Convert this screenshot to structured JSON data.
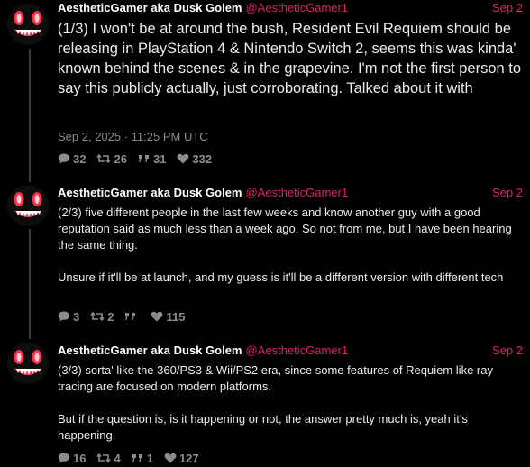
{
  "tweets": [
    {
      "author": "AestheticGamer aka Dusk Golem",
      "handle": "@AestheticGamer1",
      "date": "Sep 2",
      "text": "(1/3) I won't be at around the bush, Resident Evil Requiem should be releasing in PlayStation 4 & Nintendo Switch 2, seems this was kinda' known behind the scenes & in the grapevine. I'm not the first person to say this publicly actually, just corroborating. Talked about it with",
      "timestamp": "Sep 2, 2025 · 11:25 PM UTC",
      "stats": {
        "replies": "32",
        "retweets": "26",
        "quotes": "31",
        "likes": "332"
      }
    },
    {
      "author": "AestheticGamer aka Dusk Golem",
      "handle": "@AestheticGamer1",
      "date": "Sep 2",
      "paragraphs": [
        "(2/3) five different people in the last few weeks and know another guy with a good reputation said as much less than a week ago. So not from me, but I have been hearing the same thing.",
        "Unsure if it'll be at launch, and my guess is it'll be a different version with different tech"
      ],
      "stats": {
        "replies": "3",
        "retweets": "2",
        "quotes": "",
        "likes": "115"
      }
    },
    {
      "author": "AestheticGamer aka Dusk Golem",
      "handle": "@AestheticGamer1",
      "date": "Sep 2",
      "paragraphs": [
        "(3/3) sorta' like the 360/PS3 & Wii/PS2 era, since some features of Requiem like ray tracing are focused on modern platforms.",
        "But if the question is, is it happening or not, the answer pretty much is, yeah it's happening."
      ],
      "stats": {
        "replies": "16",
        "retweets": "4",
        "quotes": "1",
        "likes": "127"
      }
    }
  ],
  "icons": {
    "reply": "comment-icon",
    "retweet": "retweet-icon",
    "quote": "quote-icon",
    "like": "heart-icon"
  },
  "colors": {
    "background": "#000000",
    "handle": "#e0245e",
    "meta": "#8a8a8a",
    "thread_line": "#3a3a3a"
  }
}
